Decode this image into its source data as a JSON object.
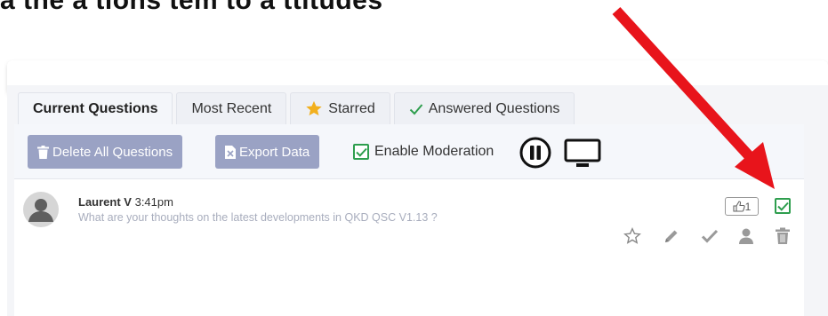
{
  "colors": {
    "accent_green": "#2e9e4e",
    "button_bg": "#9aa2c4",
    "star_gold": "#f2b01e",
    "annotation_red": "#e8141b"
  },
  "header": {
    "cut_off_text": "a the a tions tem to a ttitudes"
  },
  "tabs": [
    {
      "label": "Current Questions",
      "active": true
    },
    {
      "label": "Most Recent"
    },
    {
      "label": "Starred",
      "icon": "star-icon"
    },
    {
      "label": "Answered Questions",
      "icon": "checkmark-icon"
    }
  ],
  "toolbar": {
    "delete_all_label": "Delete All Questions",
    "export_label": "Export Data",
    "moderation_label": "Enable Moderation",
    "moderation_checked": true
  },
  "question": {
    "author": "Laurent V",
    "time": "3:41pm",
    "text": "What are your thoughts on the latest developments in QKD QSC V1.13 ?",
    "likes": "1",
    "approved": true
  },
  "annotation": {
    "type": "red-arrow",
    "points_to": "approve-checkbox"
  }
}
